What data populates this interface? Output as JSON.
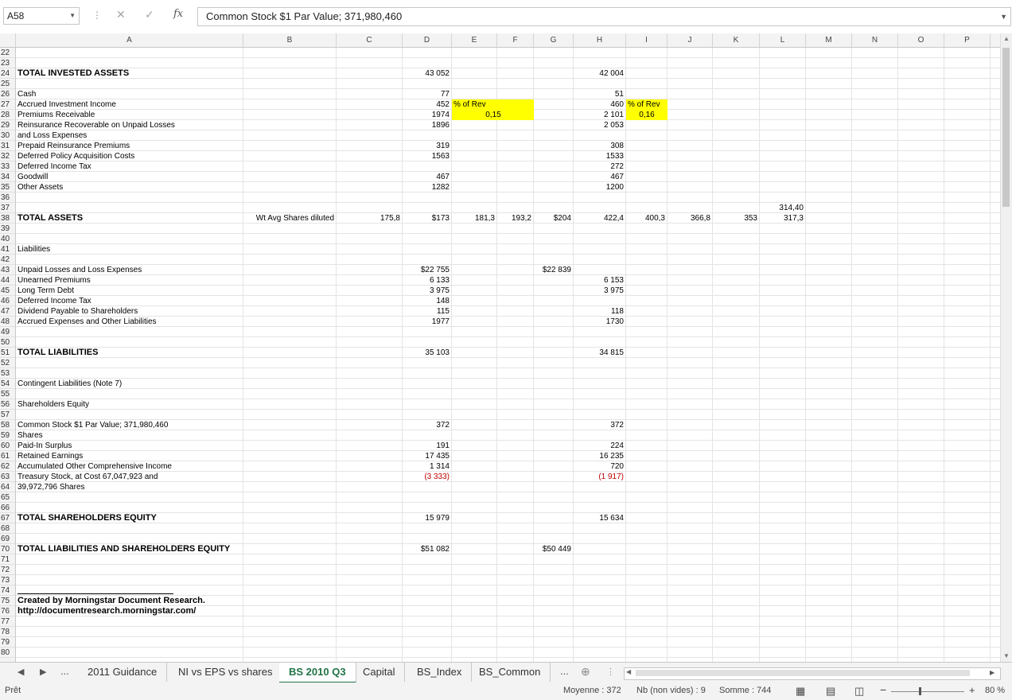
{
  "formula_bar": {
    "name_box": "A58",
    "fx": "fx",
    "content": "Common Stock $1 Par Value; 371,980,460"
  },
  "columns": [
    "A",
    "B",
    "C",
    "D",
    "E",
    "F",
    "G",
    "H",
    "I",
    "J",
    "K",
    "L",
    "M",
    "N",
    "O",
    "P"
  ],
  "rows": [
    "22",
    "23",
    "24",
    "25",
    "26",
    "27",
    "28",
    "29",
    "30",
    "31",
    "32",
    "33",
    "34",
    "35",
    "36",
    "37",
    "38",
    "39",
    "40",
    "41",
    "42",
    "43",
    "44",
    "45",
    "46",
    "47",
    "48",
    "49",
    "50",
    "51",
    "52",
    "53",
    "54",
    "55",
    "56",
    "57",
    "58",
    "59",
    "60",
    "61",
    "62",
    "63",
    "64",
    "65",
    "66",
    "67",
    "68",
    "69",
    "70",
    "71",
    "72",
    "73",
    "74",
    "75",
    "76",
    "77",
    "78",
    "79",
    "80"
  ],
  "cells": {
    "a24": "TOTAL INVESTED ASSETS",
    "d24": "43 052",
    "h24": "42 004",
    "a26": "Cash",
    "d26": "77",
    "h26": "51",
    "a27": "Accrued Investment Income",
    "d27": "452",
    "e27": "% of Rev",
    "h27": "460",
    "i27": "% of Rev",
    "a28": "Premiums Receivable",
    "d28": "1974",
    "e28": "0,15",
    "h28": "2 101",
    "i28": "0,16",
    "a29": "Reinsurance Recoverable on Unpaid Losses",
    "d29": "1896",
    "h29": "2 053",
    "a30": "and Loss Expenses",
    "a31": "Prepaid Reinsurance Premiums",
    "d31": "319",
    "h31": "308",
    "a32": "Deferred Policy Acquisition Costs",
    "d32": "1563",
    "h32": "1533",
    "a33": "Deferred Income Tax",
    "h33": "272",
    "a34": "Goodwill",
    "d34": "467",
    "h34": "467",
    "a35": "Other Assets",
    "d35": "1282",
    "h35": "1200",
    "l37": "314,40",
    "a38": "TOTAL ASSETS",
    "b38": "Wt Avg Shares diluted",
    "c38": "175,8",
    "d38": "$173",
    "e38": "181,3",
    "f38": "193,2",
    "g38": "$204",
    "h38": "422,4",
    "i38": "400,3",
    "j38": "366,8",
    "k38": "353",
    "l38": "317,3",
    "a41": "Liabilities",
    "a43": "Unpaid Losses and Loss Expenses",
    "d43": "$22 755",
    "g43": "$22 839",
    "a44": "Unearned Premiums",
    "d44": "6 133",
    "h44": "6 153",
    "a45": "Long Term Debt",
    "d45": "3 975",
    "h45": "3 975",
    "a46": "Deferred Income Tax",
    "d46": "148",
    "a47": "Dividend Payable to Shareholders",
    "d47": "115",
    "h47": "118",
    "a48": "Accrued Expenses and Other Liabilities",
    "d48": "1977",
    "h48": "1730",
    "a51": "TOTAL LIABILITIES",
    "d51": "35 103",
    "h51": "34 815",
    "a54": "Contingent Liabilities (Note 7)",
    "a56": "Shareholders Equity",
    "a58": "Common Stock $1 Par Value; 371,980,460",
    "d58": "372",
    "h58": "372",
    "a59": "Shares",
    "a60": "Paid-In Surplus",
    "d60": "191",
    "h60": "224",
    "a61": "Retained Earnings",
    "d61": "17 435",
    "h61": "16 235",
    "a62": "Accumulated Other Comprehensive Income",
    "d62": "1 314",
    "h62": "720",
    "a63": "Treasury Stock, at Cost 67,047,923 and",
    "d63": "(3 333)",
    "h63": "(1 917)",
    "a64": "39,972,796 Shares",
    "a67": "TOTAL SHAREHOLDERS EQUITY",
    "d67": "15 979",
    "h67": "15 634",
    "a70": "TOTAL LIABILITIES AND SHAREHOLDERS EQUITY",
    "d70": "$51 082",
    "g70": "$50 449",
    "a75": "Created by Morningstar Document Research.",
    "a76": "http://documentresearch.morningstar.com/"
  },
  "tabs": {
    "more_left": "...",
    "t1": "2011 Guidance",
    "t2": "NI vs EPS vs shares",
    "t3": "BS 2010 Q3",
    "t4": "Capital",
    "t5": "BS_Index",
    "t6": "BS_Common",
    "more_right": "..."
  },
  "status": {
    "ready": "Prêt",
    "average": "Moyenne : 372",
    "count": "Nb (non vides) : 9",
    "sum": "Somme : 744",
    "zoom": "80 %"
  },
  "colors": {
    "highlight": "#ffff00",
    "active_tab": "#217346",
    "negative": "#c00000"
  }
}
